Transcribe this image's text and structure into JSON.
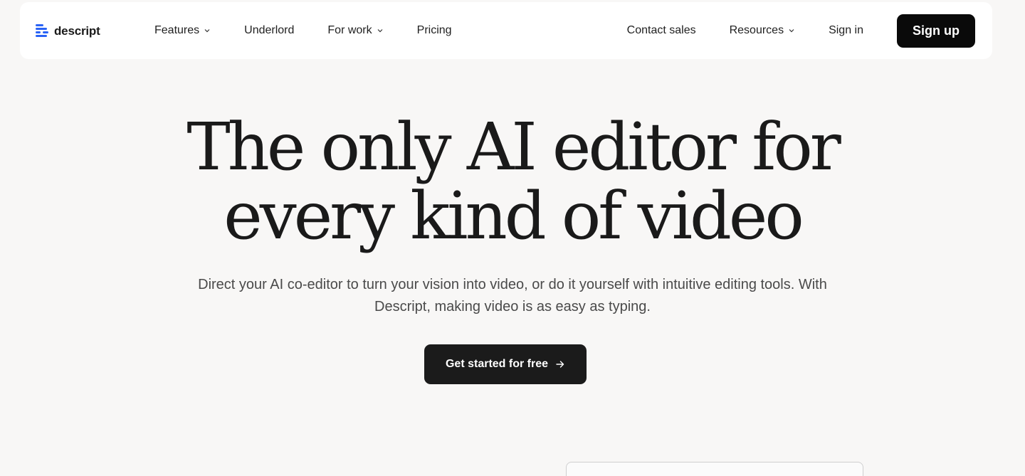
{
  "brand": {
    "name": "descript",
    "accent": "#2a63f5"
  },
  "nav": {
    "left": [
      {
        "label": "Features",
        "dropdown": true,
        "icon": "chevron-down-icon"
      },
      {
        "label": "Underlord",
        "dropdown": false
      },
      {
        "label": "For work",
        "dropdown": true,
        "icon": "chevron-down-icon"
      },
      {
        "label": "Pricing",
        "dropdown": false
      }
    ],
    "right": [
      {
        "label": "Contact sales",
        "dropdown": false
      },
      {
        "label": "Resources",
        "dropdown": true,
        "icon": "chevron-down-icon"
      },
      {
        "label": "Sign in",
        "dropdown": false
      }
    ],
    "signup_label": "Sign up"
  },
  "hero": {
    "title_line1": "The only AI editor for",
    "title_line2": "every kind of video",
    "subtitle": "Direct your AI co-editor to turn your vision into video, or do it yourself with intuitive editing tools. With Descript, making video is as easy as typing.",
    "cta_label": "Get started for free",
    "cta_icon": "arrow-right-icon"
  },
  "colors": {
    "page_bg": "#f8f7f6",
    "nav_bg": "#ffffff",
    "button_dark": "#0a0a0a"
  }
}
